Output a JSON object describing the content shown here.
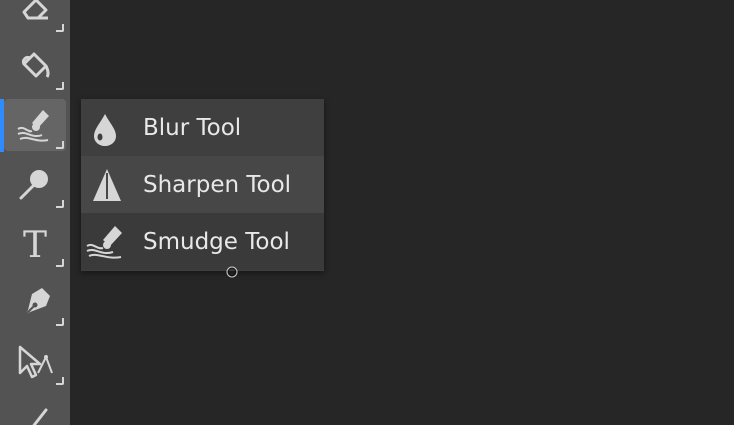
{
  "toolbar": {
    "tools": [
      {
        "icon": "eraser-icon"
      },
      {
        "icon": "paint-bucket-icon"
      },
      {
        "icon": "smudge-icon",
        "active": true
      },
      {
        "icon": "dodge-icon"
      },
      {
        "icon": "text-icon",
        "label": "T"
      },
      {
        "icon": "pen-icon"
      },
      {
        "icon": "path-selection-icon"
      },
      {
        "icon": "line-icon"
      }
    ]
  },
  "flyout": {
    "items": [
      {
        "label": "Blur Tool",
        "icon": "blur-drop-icon"
      },
      {
        "label": "Sharpen Tool",
        "icon": "sharpen-triangle-icon"
      },
      {
        "label": "Smudge Tool",
        "icon": "smudge-icon",
        "selected": true
      }
    ]
  },
  "colors": {
    "toolbar_bg": "#535353",
    "canvas_bg": "#262626",
    "flyout_bg": "#3f3f3f",
    "accent": "#2f8cff",
    "icon": "#d6d6d6",
    "text": "#e8e8e8"
  }
}
